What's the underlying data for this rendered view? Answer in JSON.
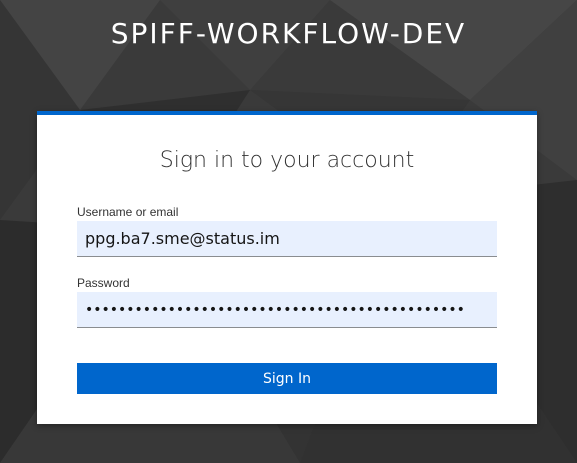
{
  "realm": {
    "title": "SPIFF-WORKFLOW-DEV"
  },
  "login": {
    "heading": "Sign in to your account",
    "username_label": "Username or email",
    "username_value": "ppg.ba7.sme@status.im",
    "password_label": "Password",
    "password_value": "••••••••••••••••••••••••••••••••••••••••••••••",
    "signin_label": "Sign In"
  },
  "colors": {
    "accent": "#0066cc",
    "input_autofill_bg": "#e8f0fe",
    "background": "#3b3b3b"
  }
}
